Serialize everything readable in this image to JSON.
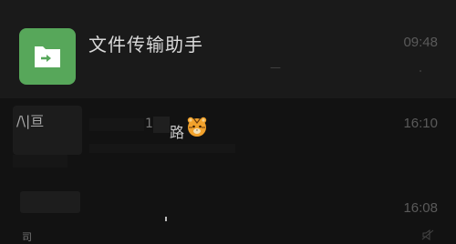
{
  "chats": [
    {
      "title": "文件传输助手",
      "time": "09:48",
      "preview": "—",
      "avatar_icon": "folder-forward-icon",
      "avatar_color": "#57a75a",
      "pinned": true
    },
    {
      "title_fragment": "16",
      "title_char": "路",
      "emoji_icon": "tiger-icon",
      "time": "16:10",
      "avatar_mark": "/\\|亘"
    },
    {
      "time": "16:08",
      "row_glyph": "司",
      "mute_icon": "mute-icon"
    }
  ],
  "colors": {
    "background": "#111111",
    "pinned_background": "#1a1a1a",
    "title_text": "#d9d9d9",
    "time_text": "#5a5a5a",
    "accent_green": "#57a75a"
  }
}
